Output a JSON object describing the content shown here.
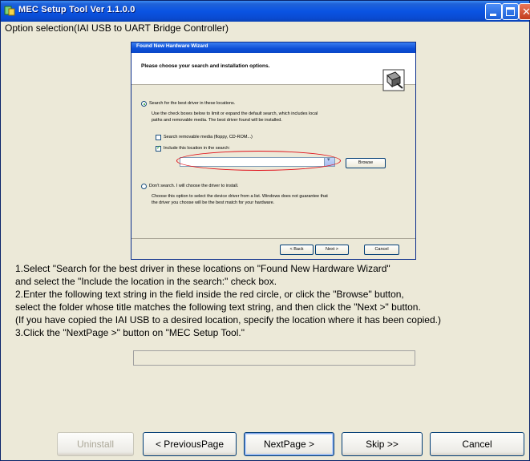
{
  "window": {
    "title": "MEC Setup Tool  Ver 1.1.0.0"
  },
  "option_label": "Option selection(IAI USB to UART Bridge Controller)",
  "wizard": {
    "title": "Found New Hardware Wizard",
    "header": "Please choose your search and installation options.",
    "radio_search": "Search for the best driver in these locations.",
    "search_desc_1": "Use the check boxes below to limit or expand the default search, which includes local",
    "search_desc_2": "paths and removable media. The best driver found will be installed.",
    "check_removable": "Search removable media (floppy, CD-ROM...)",
    "check_include": "Include this location in the search:",
    "browse": "Browse",
    "radio_dont_search": "Don't search. I will choose the driver to install.",
    "dont_desc_1": "Choose this option to select the device driver from a list.  Windows does not guarantee that",
    "dont_desc_2": "the driver you choose will be the best match for your hardware.",
    "back": "< Back",
    "next": "Next >",
    "cancel": "Cancel"
  },
  "instructions": [
    "1.Select \"Search for the best driver in these locations on \"Found New Hardware Wizard\"",
    "  and select the \"Include the location in the search:\" check box.",
    "2.Enter the following text string in the field inside the red circle, or click the \"Browse\" button,",
    "  select the folder whose title matches the following text string, and then click the \"Next >\" button.",
    "  (If you have copied the IAI USB to a desired location, specify the location where it has been copied.)",
    "3.Click the \"NextPage >\" button on \"MEC Setup Tool.\""
  ],
  "path_field": {
    "value": ""
  },
  "buttons": {
    "uninstall": "Uninstall",
    "previous": "< PreviousPage",
    "next": "NextPage >",
    "skip": "Skip >>",
    "cancel": "Cancel"
  },
  "colors": {
    "titlebar": "#0a54e3",
    "window_bg": "#ece9d8",
    "highlight_circle": "#e0101a"
  },
  "icons": {
    "app": "app-icon",
    "hardware": "hardware-icon"
  }
}
